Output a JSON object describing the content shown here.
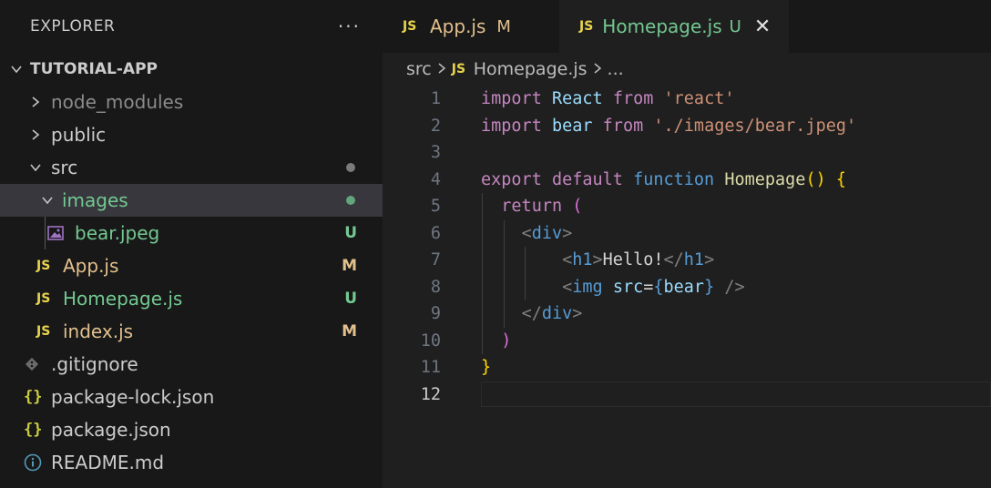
{
  "explorer": {
    "title": "EXPLORER",
    "more": "···",
    "project": "TUTORIAL-APP",
    "items": [
      {
        "label": "node_modules",
        "type": "folder",
        "expanded": false,
        "color": "#8b8b8b"
      },
      {
        "label": "public",
        "type": "folder",
        "expanded": false,
        "color": "#cccccc"
      },
      {
        "label": "src",
        "type": "folder",
        "expanded": true,
        "color": "#cccccc"
      },
      {
        "label": "images",
        "type": "folder",
        "expanded": true,
        "color": "#73c991"
      },
      {
        "label": "bear.jpeg",
        "type": "image",
        "badge": "U",
        "color": "#73c991"
      },
      {
        "label": "App.js",
        "type": "js",
        "badge": "M",
        "color": "#e2c08d"
      },
      {
        "label": "Homepage.js",
        "type": "js",
        "badge": "U",
        "color": "#73c991"
      },
      {
        "label": "index.js",
        "type": "js",
        "badge": "M",
        "color": "#e2c08d"
      },
      {
        "label": ".gitignore",
        "type": "git",
        "color": "#cccccc"
      },
      {
        "label": "package-lock.json",
        "type": "json",
        "color": "#cccccc"
      },
      {
        "label": "package.json",
        "type": "json",
        "color": "#cccccc"
      },
      {
        "label": "README.md",
        "type": "info",
        "color": "#cccccc"
      }
    ]
  },
  "tabs": [
    {
      "icon": "JS",
      "label": "App.js",
      "mark": "M",
      "color": "#e2c08d"
    },
    {
      "icon": "JS",
      "label": "Homepage.js",
      "mark": "U",
      "color": "#73c991",
      "close": "✕"
    }
  ],
  "breadcrumb": {
    "folder": "src",
    "icon": "JS",
    "file": "Homepage.js",
    "more": "..."
  },
  "line_numbers": [
    "1",
    "2",
    "3",
    "4",
    "5",
    "6",
    "7",
    "8",
    "9",
    "10",
    "11",
    "12"
  ],
  "code": {
    "l1": {
      "import": "import",
      "React": "React",
      "from": "from",
      "str": "'react'"
    },
    "l2": {
      "import": "import",
      "bear": "bear",
      "from": "from",
      "str": "'./images/bear.jpeg'"
    },
    "l4": {
      "export": "export",
      "default": "default",
      "function": "function",
      "name": "Homepage",
      "parens": "()",
      "brace": "{"
    },
    "l5": {
      "return": "return",
      "paren": "("
    },
    "l6": {
      "open": "<",
      "tag": "div",
      "close": ">"
    },
    "l7": {
      "open": "<",
      "tag": "h1",
      "close": ">",
      "text": "Hello!",
      "endopen": "</",
      "endtag": "h1",
      "endclose": ">"
    },
    "l8": {
      "open": "<",
      "tag": "img",
      "attr": "src",
      "eq": "=",
      "lb": "{",
      "val": "bear",
      "rb": "}",
      "selfclose": "/>"
    },
    "l9": {
      "endopen": "</",
      "tag": "div",
      "close": ">"
    },
    "l10": {
      "paren": ")"
    },
    "l11": {
      "brace": "}"
    }
  },
  "colors": {
    "untracked": "#73c991",
    "modified": "#e2c08d",
    "js_icon": "#e8d44d",
    "dot": "#7a7a7a"
  }
}
